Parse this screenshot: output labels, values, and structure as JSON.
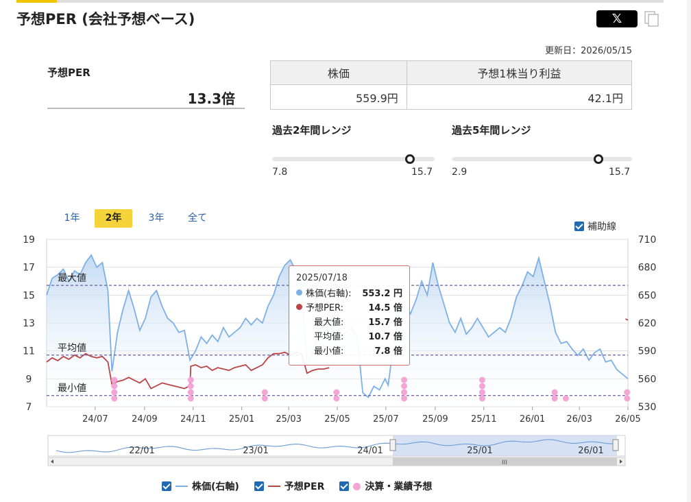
{
  "page": {
    "title": "予想PER (会社予想ベース)",
    "share_x_label": "𝕏",
    "update_date": "更新日：2026/05/15"
  },
  "summary": {
    "per_label": "予想PER",
    "per_value": "13.3倍",
    "table_headers": [
      "株価",
      "予想1株当り利益"
    ],
    "table_values": [
      "559.9円",
      "42.1円"
    ]
  },
  "ranges": [
    {
      "title": "過去2年間レンジ",
      "min": "7.8",
      "max": "15.7",
      "current": 14.5
    },
    {
      "title": "過去5年間レンジ",
      "min": "2.9",
      "max": "15.7",
      "current": 13.3
    }
  ],
  "period_tabs": [
    "1年",
    "2年",
    "3年",
    "全て"
  ],
  "active_tab": "2年",
  "aux_lines_label": "補助線",
  "tooltip": {
    "date": "2025/07/18",
    "rows": [
      {
        "label": "株価(右軸):",
        "value": "553.2 円",
        "color": "#7cb0e6"
      },
      {
        "label": "予想PER:",
        "value": "14.5 倍",
        "color": "#b84444"
      },
      {
        "label": "最大値:",
        "value": "15.7 倍"
      },
      {
        "label": "平均値:",
        "value": "10.7 倍"
      },
      {
        "label": "最小値:",
        "value": "7.8 倍"
      }
    ]
  },
  "legend": [
    {
      "label": "株価(右軸)",
      "color": "#7cb0e6",
      "kind": "line"
    },
    {
      "label": "予想PER",
      "color": "#b84444",
      "kind": "line"
    },
    {
      "label": "決算・業績予想",
      "color": "#f3a6d6",
      "kind": "dot"
    }
  ],
  "chart_data": {
    "type": "line",
    "x_range": [
      "2024-05-15",
      "2026-05-15"
    ],
    "x_ticks": [
      "24/07",
      "24/09",
      "24/11",
      "25/01",
      "25/03",
      "25/05",
      "25/07",
      "25/09",
      "25/11",
      "26/01",
      "26/03",
      "26/05"
    ],
    "y_left_ticks": [
      "19",
      "17",
      "15",
      "13",
      "11",
      "9",
      "7"
    ],
    "y_left_range": [
      7,
      19
    ],
    "y_right_ticks": [
      "710",
      "680",
      "650",
      "620",
      "590",
      "560",
      "530"
    ],
    "y_right_range": [
      530,
      710
    ],
    "grid": true,
    "reference_lines": [
      {
        "label": "最大値",
        "value": 15.7
      },
      {
        "label": "平均値",
        "value": 10.7
      },
      {
        "label": "最小値",
        "value": 7.8
      }
    ],
    "series": [
      {
        "name": "株価(右軸)",
        "axis": "right",
        "color": "#7cb0e6",
        "points": [
          [
            "2024-05-15",
            650
          ],
          [
            "2024-05-22",
            668
          ],
          [
            "2024-05-29",
            672
          ],
          [
            "2024-06-05",
            678
          ],
          [
            "2024-06-12",
            665
          ],
          [
            "2024-06-19",
            676
          ],
          [
            "2024-06-26",
            672
          ],
          [
            "2024-07-03",
            685
          ],
          [
            "2024-07-10",
            693
          ],
          [
            "2024-07-17",
            680
          ],
          [
            "2024-07-24",
            685
          ],
          [
            "2024-07-31",
            655
          ],
          [
            "2024-08-05",
            568
          ],
          [
            "2024-08-12",
            610
          ],
          [
            "2024-08-19",
            635
          ],
          [
            "2024-08-26",
            655
          ],
          [
            "2024-09-02",
            635
          ],
          [
            "2024-09-09",
            612
          ],
          [
            "2024-09-16",
            625
          ],
          [
            "2024-09-23",
            648
          ],
          [
            "2024-09-30",
            655
          ],
          [
            "2024-10-07",
            638
          ],
          [
            "2024-10-14",
            625
          ],
          [
            "2024-10-21",
            620
          ],
          [
            "2024-10-28",
            610
          ],
          [
            "2024-11-04",
            612
          ],
          [
            "2024-11-11",
            580
          ],
          [
            "2024-11-18",
            590
          ],
          [
            "2024-11-25",
            605
          ],
          [
            "2024-12-02",
            598
          ],
          [
            "2024-12-09",
            607
          ],
          [
            "2024-12-16",
            600
          ],
          [
            "2024-12-23",
            615
          ],
          [
            "2024-12-30",
            605
          ],
          [
            "2025-01-06",
            610
          ],
          [
            "2025-01-13",
            615
          ],
          [
            "2025-01-20",
            625
          ],
          [
            "2025-01-27",
            618
          ],
          [
            "2025-02-03",
            625
          ],
          [
            "2025-02-10",
            620
          ],
          [
            "2025-02-17",
            638
          ],
          [
            "2025-02-24",
            650
          ],
          [
            "2025-03-03",
            670
          ],
          [
            "2025-03-10",
            682
          ],
          [
            "2025-03-17",
            688
          ],
          [
            "2025-03-24",
            676
          ],
          [
            "2025-03-31",
            660
          ],
          [
            "2025-04-07",
            575
          ],
          [
            "2025-04-14",
            590
          ],
          [
            "2025-04-21",
            605
          ],
          [
            "2025-04-28",
            612
          ],
          [
            "2025-05-05",
            620
          ],
          [
            "2025-05-12",
            630
          ],
          [
            "2025-05-19",
            605
          ],
          [
            "2025-05-26",
            610
          ],
          [
            "2025-06-02",
            615
          ],
          [
            "2025-06-09",
            605
          ],
          [
            "2025-06-16",
            545
          ],
          [
            "2025-06-23",
            540
          ],
          [
            "2025-06-30",
            552
          ],
          [
            "2025-07-07",
            548
          ],
          [
            "2025-07-14",
            560
          ],
          [
            "2025-07-18",
            553
          ],
          [
            "2025-07-25",
            600
          ],
          [
            "2025-08-01",
            635
          ],
          [
            "2025-08-08",
            640
          ],
          [
            "2025-08-15",
            630
          ],
          [
            "2025-08-22",
            645
          ],
          [
            "2025-08-29",
            665
          ],
          [
            "2025-09-05",
            650
          ],
          [
            "2025-09-12",
            685
          ],
          [
            "2025-09-19",
            660
          ],
          [
            "2025-09-26",
            640
          ],
          [
            "2025-10-03",
            620
          ],
          [
            "2025-10-10",
            610
          ],
          [
            "2025-10-17",
            625
          ],
          [
            "2025-10-24",
            608
          ],
          [
            "2025-10-31",
            615
          ],
          [
            "2025-11-07",
            625
          ],
          [
            "2025-11-14",
            615
          ],
          [
            "2025-11-21",
            605
          ],
          [
            "2025-11-28",
            610
          ],
          [
            "2025-12-05",
            615
          ],
          [
            "2025-12-12",
            610
          ],
          [
            "2025-12-19",
            625
          ],
          [
            "2025-12-26",
            648
          ],
          [
            "2026-01-02",
            660
          ],
          [
            "2026-01-09",
            675
          ],
          [
            "2026-01-16",
            670
          ],
          [
            "2026-01-23",
            690
          ],
          [
            "2026-01-30",
            665
          ],
          [
            "2026-02-06",
            640
          ],
          [
            "2026-02-13",
            610
          ],
          [
            "2026-02-20",
            598
          ],
          [
            "2026-02-27",
            600
          ],
          [
            "2026-03-06",
            592
          ],
          [
            "2026-03-13",
            585
          ],
          [
            "2026-03-20",
            592
          ],
          [
            "2026-03-27",
            580
          ],
          [
            "2026-04-03",
            588
          ],
          [
            "2026-04-10",
            592
          ],
          [
            "2026-04-17",
            578
          ],
          [
            "2026-04-24",
            580
          ],
          [
            "2026-05-01",
            570
          ],
          [
            "2026-05-08",
            565
          ],
          [
            "2026-05-15",
            560
          ]
        ]
      },
      {
        "name": "予想PER",
        "axis": "left",
        "color": "#b84444",
        "points": [
          [
            "2024-05-15",
            10.2
          ],
          [
            "2024-05-22",
            10.5
          ],
          [
            "2024-05-29",
            10.3
          ],
          [
            "2024-06-05",
            10.6
          ],
          [
            "2024-06-12",
            10.4
          ],
          [
            "2024-06-19",
            10.7
          ],
          [
            "2024-06-26",
            10.5
          ],
          [
            "2024-07-03",
            10.8
          ],
          [
            "2024-07-10",
            10.6
          ],
          [
            "2024-07-17",
            10.5
          ],
          [
            "2024-07-24",
            10.6
          ],
          [
            "2024-07-31",
            10.2
          ],
          [
            "2024-08-05",
            8.6
          ],
          [
            "2024-08-12",
            8.8
          ],
          [
            "2024-08-19",
            8.9
          ],
          [
            "2024-08-26",
            9.1
          ],
          [
            "2024-09-02",
            8.9
          ],
          [
            "2024-09-09",
            8.7
          ],
          [
            "2024-09-16",
            9.0
          ],
          [
            "2024-09-23",
            8.3
          ],
          [
            "2024-09-30",
            8.5
          ],
          [
            "2024-10-07",
            8.7
          ],
          [
            "2024-10-14",
            8.6
          ],
          [
            "2024-10-21",
            8.5
          ],
          [
            "2024-10-28",
            8.4
          ],
          [
            "2024-11-04",
            8.3
          ],
          [
            "2024-11-11",
            8.5
          ],
          [
            "2024-11-12",
            9.9
          ],
          [
            "2024-11-18",
            10.0
          ],
          [
            "2024-11-25",
            9.8
          ],
          [
            "2024-12-02",
            9.9
          ],
          [
            "2024-12-09",
            9.6
          ],
          [
            "2024-12-16",
            9.8
          ],
          [
            "2024-12-23",
            9.7
          ],
          [
            "2024-12-30",
            9.6
          ],
          [
            "2025-01-06",
            9.8
          ],
          [
            "2025-01-13",
            9.9
          ],
          [
            "2025-01-20",
            10.0
          ],
          [
            "2025-01-27",
            9.6
          ],
          [
            "2025-02-03",
            9.8
          ],
          [
            "2025-02-10",
            10.0
          ],
          [
            "2025-02-17",
            10.5
          ],
          [
            "2025-02-24",
            10.8
          ],
          [
            "2025-03-03",
            10.8
          ],
          [
            "2025-03-10",
            10.9
          ],
          [
            "2025-03-17",
            10.7
          ],
          [
            "2025-03-24",
            10.9
          ],
          [
            "2025-03-31",
            10.8
          ],
          [
            "2025-04-07",
            9.4
          ],
          [
            "2025-04-14",
            9.6
          ],
          [
            "2025-04-21",
            9.7
          ],
          [
            "2025-04-28",
            9.7
          ],
          [
            "2025-05-05",
            9.8
          ]
        ]
      },
      {
        "name": "予想PER",
        "axis": "left",
        "color": "#b84444",
        "points": [
          [
            "2026-05-12",
            13.3
          ],
          [
            "2026-05-15",
            13.2
          ]
        ]
      }
    ],
    "events": {
      "name": "決算・業績予想",
      "color": "#f3a6d6",
      "dates": [
        "2024-08-08",
        "2024-11-12",
        "2025-02-13",
        "2025-05-14",
        "2025-08-07",
        "2025-11-13",
        "2026-02-12",
        "2026-02-26",
        "2026-05-14"
      ],
      "stack_counts": [
        4,
        4,
        2,
        2,
        4,
        4,
        2,
        1,
        2
      ]
    }
  },
  "navigator": {
    "x_ticks": [
      "22/01",
      "23/01",
      "24/01",
      "25/01",
      "26/01"
    ],
    "scroll_grip": "III"
  }
}
